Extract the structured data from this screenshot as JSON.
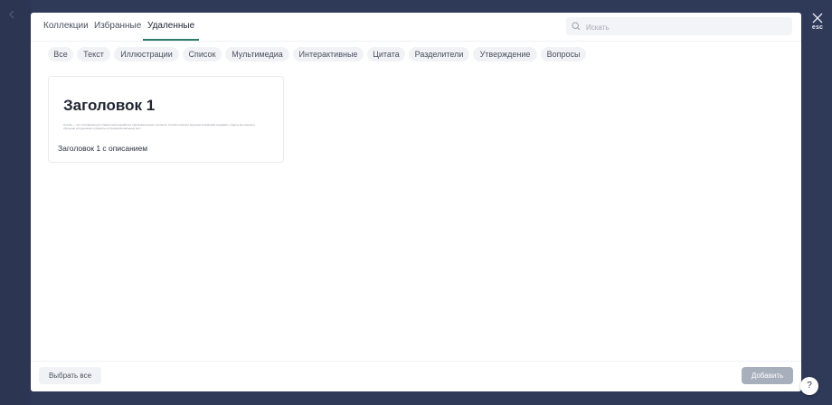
{
  "tabs": [
    {
      "label": "Коллекции"
    },
    {
      "label": "Избранные"
    },
    {
      "label": "Удаленные"
    }
  ],
  "search": {
    "placeholder": "Искать"
  },
  "filters": [
    {
      "label": "Все"
    },
    {
      "label": "Текст"
    },
    {
      "label": "Иллюстрации"
    },
    {
      "label": "Список"
    },
    {
      "label": "Мультимедиа"
    },
    {
      "label": "Интерактивные"
    },
    {
      "label": "Цитата"
    },
    {
      "label": "Разделители"
    },
    {
      "label": "Утверждение"
    },
    {
      "label": "Вопросы"
    }
  ],
  "card": {
    "title": "Заголовок 1",
    "description": "Umnda — это платформа для совместной разработки образовательного контента. Umnda помогает крупным компаниям создавать отделы внутреннего обучения сотрудников и ускорять их профессиональный рост",
    "caption": "Заголовок 1 с описанием"
  },
  "footer": {
    "select_all_label": "Выбрать все",
    "add_label": "Добавить"
  },
  "close": {
    "label": "esc"
  },
  "help": {
    "label": "?"
  },
  "colors": {
    "backdrop": "#2f3a58",
    "accent": "#2f7d6d",
    "add_button_disabled": "#a7afbd"
  }
}
